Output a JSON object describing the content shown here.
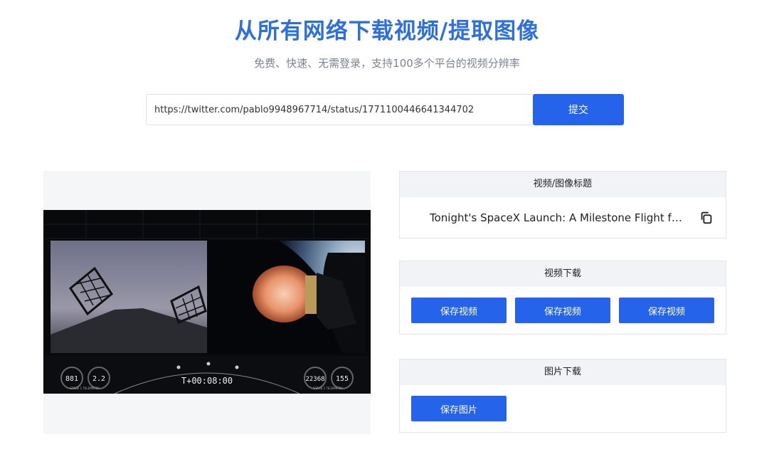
{
  "header": {
    "title": "从所有网络下载视频/提取图像",
    "subtitle": "免费、快速、无需登录，支持100多个平台的视频分辨率"
  },
  "search": {
    "url_value": "https://twitter.com/pablo9948967714/status/1771100446641344702",
    "submit_label": "提交"
  },
  "preview": {
    "hud": {
      "stage1_speed": "881",
      "stage1_altitude": "2.2",
      "stage1_label": "STAGE 1 TELEMETRY",
      "timer": "T+00:08:00",
      "stage2_speed": "22368",
      "stage2_altitude": "155",
      "stage2_label": "STAGE 2 TELEMETRY"
    }
  },
  "title_card": {
    "heading": "视频/图像标题",
    "text": "Tonight's SpaceX Launch: A Milestone Flight for a...",
    "copy_icon": "copy-icon"
  },
  "video_card": {
    "heading": "视频下载",
    "buttons": [
      "保存视频",
      "保存视频",
      "保存视频"
    ]
  },
  "image_card": {
    "heading": "图片下载",
    "button": "保存图片"
  },
  "colors": {
    "accent": "#2563eb",
    "title": "#2d6fe0"
  }
}
